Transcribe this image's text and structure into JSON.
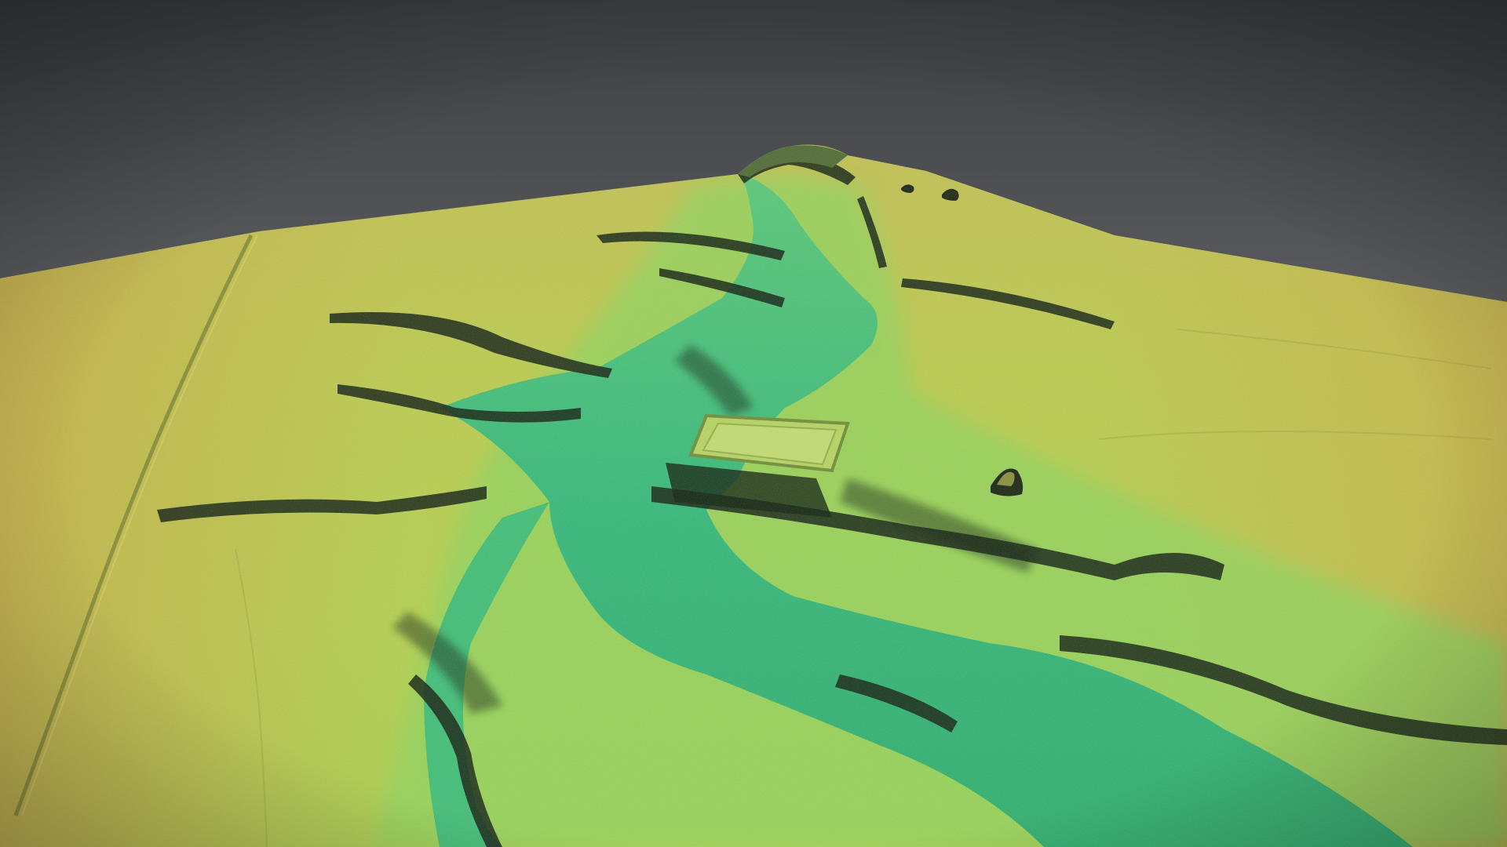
{
  "scene": {
    "kind": "3d-lidar-terrain",
    "labels": []
  },
  "colors": {
    "sky_top": "#3d3f42",
    "sky_horizon": "#8a8c8e",
    "valley_floor": "#2fbf7a",
    "valley_mid": "#6fcf6a",
    "slope_low": "#a8d24e",
    "plateau": "#c9c64a",
    "plateau_warm": "#c7b246",
    "shadow": "#0d1a0c"
  },
  "features": [
    {
      "name": "valley",
      "kind": "river-valley"
    },
    {
      "name": "summit",
      "kind": "peak"
    },
    {
      "name": "ridge-left",
      "kind": "hillside"
    },
    {
      "name": "ridge-right",
      "kind": "hillside"
    },
    {
      "name": "enclosure",
      "kind": "square-earthwork"
    },
    {
      "name": "track",
      "kind": "linear-track"
    },
    {
      "name": "cairn-1",
      "kind": "mound"
    },
    {
      "name": "cairn-2",
      "kind": "mound"
    },
    {
      "name": "cairn-3",
      "kind": "mound"
    }
  ]
}
